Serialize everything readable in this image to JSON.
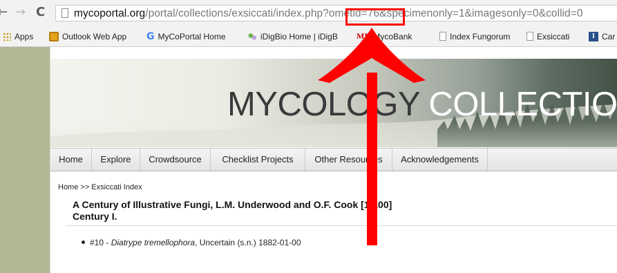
{
  "browser": {
    "url_domain": "mycoportal.org",
    "url_path": "/portal/collections/exsiccati/index.php?ometid=76&specimenonly=1&imagesonly=0&collid=0",
    "bookmarks": [
      {
        "label": "Apps",
        "icon": "apps-grid-icon"
      },
      {
        "label": "Outlook Web App",
        "icon": "outlook-icon"
      },
      {
        "label": "MyCoPortal Home",
        "icon": "google-icon"
      },
      {
        "label": "iDigBio Home | iDigB",
        "icon": "idigbio-icon"
      },
      {
        "label": "MycoBank",
        "icon": "mycobank-icon"
      },
      {
        "label": "Index Fungorum",
        "icon": "page-icon"
      },
      {
        "label": "Exsiccati",
        "icon": "page-icon"
      },
      {
        "label": "Car",
        "icon": "bookmark-logo-icon"
      }
    ],
    "icon_text": {
      "google": "G",
      "mycobank": "MB",
      "car_logo": "I"
    }
  },
  "site": {
    "banner_title_1": "MYCOLOGY",
    "banner_title_2": "COLLECTION",
    "nav": [
      "Home",
      "Explore",
      "Crowdsource",
      "Checklist Projects",
      "Other Resources",
      "Acknowledgements"
    ],
    "breadcrumb": "Home >> Exsiccati Index",
    "heading_line1": "A Century of Illustrative Fungi, L.M. Underwood and O.F. Cook [1-100]",
    "heading_line2": "Century I.",
    "record": {
      "prefix": "#10 - ",
      "taxon": "Diatrype tremellophora",
      "rest": ", Uncertain (s.n.) 1882-01-00"
    }
  },
  "annotation": {
    "color": "#ff0000",
    "highlighted_text": "ometid=76"
  },
  "colors": {
    "sidebar": "#b2b796",
    "banner_dark": "#445247",
    "chrome": "#f2f2f2"
  }
}
